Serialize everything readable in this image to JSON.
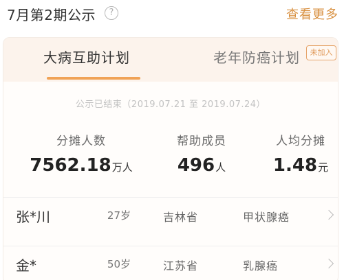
{
  "header": {
    "title": "7月第2期公示",
    "help_icon": "question-circle-icon",
    "more_label": "查看更多"
  },
  "tabs": [
    {
      "label": "大病互助计划",
      "active": true
    },
    {
      "label": "老年防癌计划",
      "active": false,
      "badge": "未加入"
    }
  ],
  "notice": "公示已结束（2019.07.21 至 2019.07.24）",
  "stats": [
    {
      "label": "分摊人数",
      "value": "7562.18",
      "unit": "万人"
    },
    {
      "label": "帮助成员",
      "value": "496",
      "unit": "人"
    },
    {
      "label": "人均分摊",
      "value": "1.48",
      "unit": "元"
    }
  ],
  "members": [
    {
      "name": "张*川",
      "age": "27岁",
      "province": "吉林省",
      "disease": "甲状腺癌"
    },
    {
      "name": "金*",
      "age": "50岁",
      "province": "江苏省",
      "disease": "乳腺癌"
    }
  ],
  "colors": {
    "accent": "#f0a256",
    "link": "#d89040",
    "tab_bg": "#fcf3ec"
  }
}
